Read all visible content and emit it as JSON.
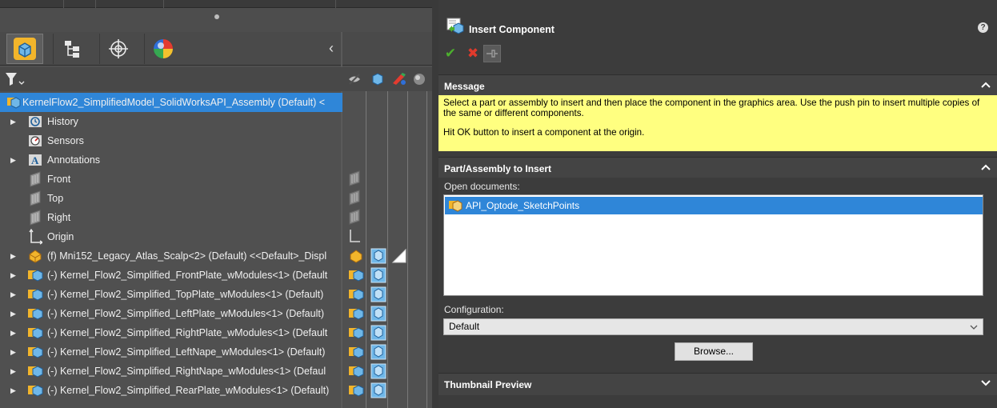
{
  "tree": {
    "root_label": "KernelFlow2_SimplifiedModel_SolidWorksAPI_Assembly (Default) <",
    "items": [
      {
        "label": "History",
        "arrow": true,
        "icon": "history-icon"
      },
      {
        "label": "Sensors",
        "arrow": false,
        "icon": "sensors-icon"
      },
      {
        "label": "Annotations",
        "arrow": true,
        "icon": "annotations-icon"
      },
      {
        "label": "Front",
        "arrow": false,
        "icon": "plane-icon"
      },
      {
        "label": "Top",
        "arrow": false,
        "icon": "plane-icon"
      },
      {
        "label": "Right",
        "arrow": false,
        "icon": "plane-icon"
      },
      {
        "label": "Origin",
        "arrow": false,
        "icon": "origin-icon"
      },
      {
        "label": "(f) Mni152_Legacy_Atlas_Scalp<2> (Default) <<Default>_Displ",
        "arrow": true,
        "icon": "part-icon"
      },
      {
        "label": "(-) Kernel_Flow2_Simplified_FrontPlate_wModules<1> (Default",
        "arrow": true,
        "icon": "assembly-icon"
      },
      {
        "label": "(-) Kernel_Flow2_Simplified_TopPlate_wModules<1> (Default)",
        "arrow": true,
        "icon": "assembly-icon"
      },
      {
        "label": "(-) Kernel_Flow2_Simplified_LeftPlate_wModules<1> (Default)",
        "arrow": true,
        "icon": "assembly-icon"
      },
      {
        "label": "(-) Kernel_Flow2_Simplified_RightPlate_wModules<1> (Default",
        "arrow": true,
        "icon": "assembly-icon"
      },
      {
        "label": "(-) Kernel_Flow2_Simplified_LeftNape_wModules<1> (Default)",
        "arrow": true,
        "icon": "assembly-icon"
      },
      {
        "label": "(-) Kernel_Flow2_Simplified_RightNape_wModules<1> (Defaul",
        "arrow": true,
        "icon": "assembly-icon"
      },
      {
        "label": "(-) Kernel_Flow2_Simplified_RearPlate_wModules<1> (Default)",
        "arrow": true,
        "icon": "assembly-icon"
      }
    ]
  },
  "property_manager": {
    "title": "Insert Component",
    "help": "?",
    "message_section": {
      "title": "Message",
      "line1": "Select a part or assembly to insert and then place the component in the graphics area. Use the push pin to insert multiple copies of the same or different components.",
      "line2": "Hit OK button to insert a component at the origin."
    },
    "part_section": {
      "title": "Part/Assembly to Insert",
      "open_documents_label": "Open documents:",
      "documents": [
        "API_Optode_SketchPoints"
      ],
      "configuration_label": "Configuration:",
      "configuration_value": "Default",
      "browse_label": "Browse..."
    },
    "thumbnail_section": {
      "title": "Thumbnail Preview"
    }
  },
  "colors": {
    "tree_bg": "#505050",
    "panel_bg": "#3c3c3c",
    "selection_blue": "#2f86d8",
    "message_yellow": "#ffff80",
    "ok_green": "#4caf2e",
    "cancel_red": "#e03a2c"
  }
}
